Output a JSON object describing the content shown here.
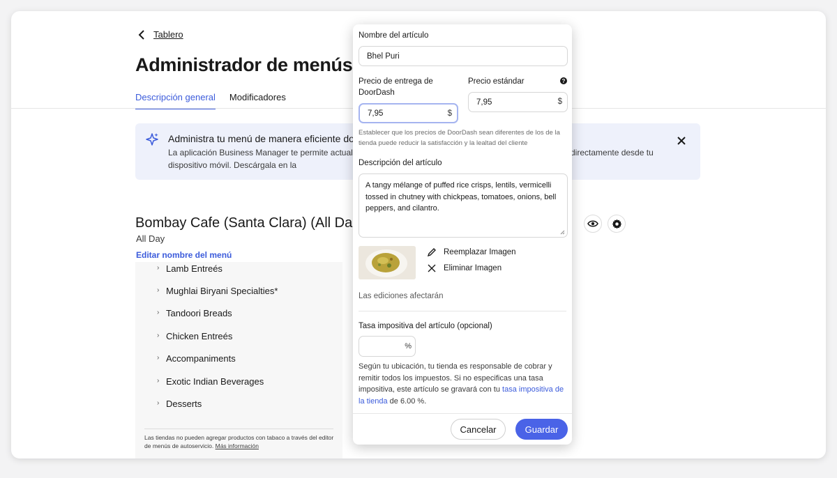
{
  "page": {
    "back_label": "Tablero",
    "title": "Administrador de menús",
    "tabs": [
      "Descripción general",
      "Modificadores"
    ]
  },
  "banner": {
    "title": "Administra tu menú de manera eficiente do",
    "body_line1": "La aplicación Business Manager te permite actualiz",
    "body_line2": "dispositivo móvil. Descárgala en la",
    "body_right": "directamente desde tu"
  },
  "menu": {
    "name": "Bombay Cafe (Santa Clara) (All Da",
    "subtitle": "All Day",
    "edit_label": "Editar nombre del menú",
    "categories": [
      "Lamb Entreés",
      "Mughlai Biryani Specialties*",
      "Tandoori Breads",
      "Chicken Entreés",
      "Accompaniments",
      "Exotic Indian Beverages",
      "Desserts"
    ],
    "note": "Las tiendas no pueden agregar productos con tabaco a través del editor de menús de autoservicio.",
    "note_link": "Más información"
  },
  "modal": {
    "item_name_label": "Nombre del artículo",
    "item_name_value": "Bhel Puri",
    "dd_price_label": "Precio de entrega de DoorDash",
    "dd_price_value": "7,95",
    "std_price_label": "Precio estándar",
    "std_price_value": "7,95",
    "currency": "$",
    "price_note": "Establecer que los precios de DoorDash sean diferentes de los de la tienda puede reducir la satisfacción y la lealtad del cliente",
    "desc_label": "Descripción del artículo",
    "desc_value": "A tangy mélange of puffed rice crisps, lentils, vermicelli tossed in chutney with chickpeas, tomatoes, onions, bell peppers, and cilantro.",
    "replace_image": "Reemplazar Imagen",
    "remove_image": "Eliminar Imagen",
    "edits_note": "Las ediciones afectarán",
    "tax_label": "Tasa impositiva del artículo (opcional)",
    "tax_unit": "%",
    "tax_text_pre": "Según tu ubicación, tu tienda es responsable de cobrar y remitir todos los impuestos. Si no especificas una tasa impositiva, este artículo se gravará con tu",
    "tax_link": "tasa impositiva de la tienda",
    "tax_text_post": "de 6.00 %.",
    "cancel": "Cancelar",
    "save": "Guardar"
  },
  "colors": {
    "accent": "#4a63e7",
    "link": "#3b5bdb",
    "banner_bg": "#eef1fb"
  }
}
